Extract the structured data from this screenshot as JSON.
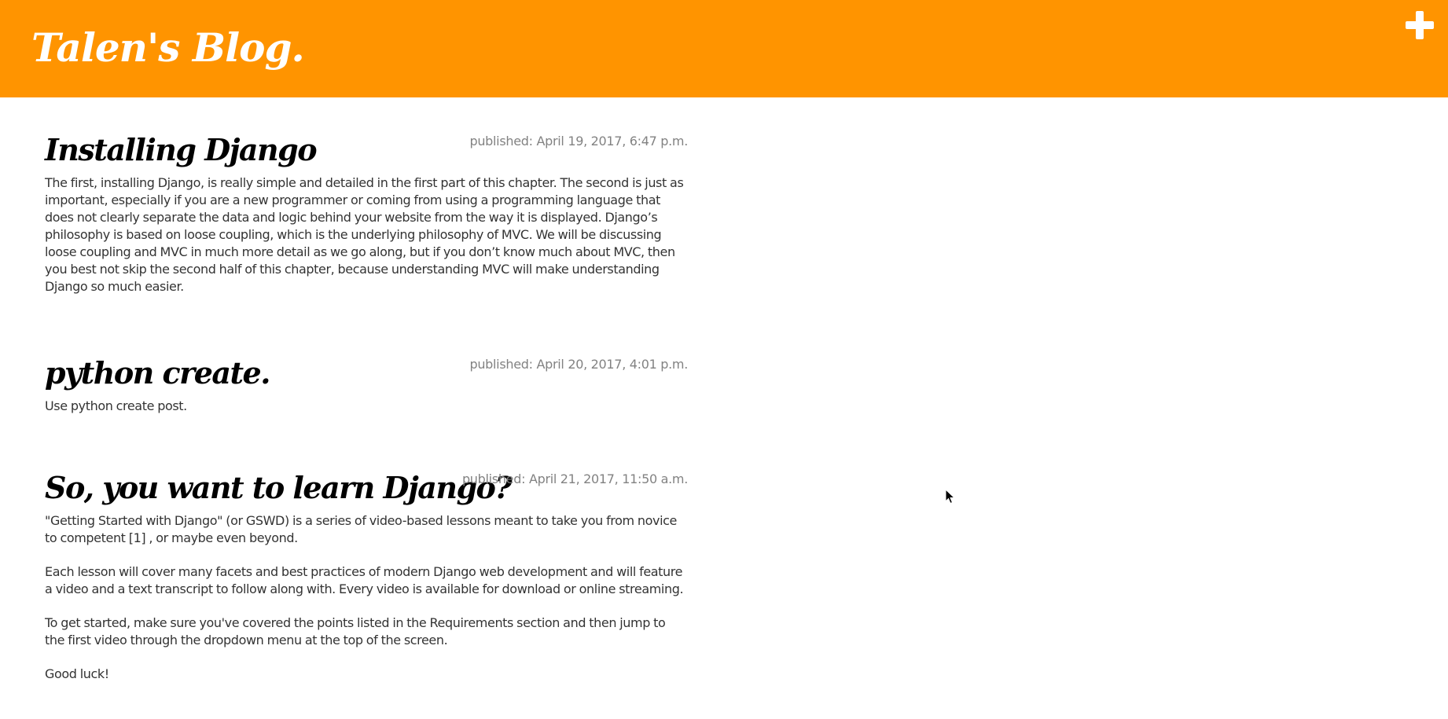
{
  "header": {
    "site_title": "Talen's Blog.",
    "add_icon": "plus-icon",
    "background_color": "#ff9400"
  },
  "posts": [
    {
      "title": "Installing Django",
      "date": "published: April 19, 2017, 6:47 p.m.",
      "paragraphs": [
        "The first, installing Django, is really simple and detailed in the first part of this chapter. The second is just as important, especially if you are a new programmer or coming from using a programming language that does not clearly separate the data and logic behind your website from the way it is displayed. Django’s philosophy is based on loose coupling, which is the underlying philosophy of MVC. We will be discussing loose coupling and MVC in much more detail as we go along, but if you don’t know much about MVC, then you best not skip the second half of this chapter, because understanding MVC will make understanding Django so much easier."
      ]
    },
    {
      "title": "python create.",
      "date": "published: April 20, 2017, 4:01 p.m.",
      "paragraphs": [
        "Use python create post."
      ]
    },
    {
      "title": "So, you want to learn Django?",
      "date": "published: April 21, 2017, 11:50 a.m.",
      "paragraphs": [
        "\"Getting Started with Django\" (or GSWD) is a series of video-based lessons meant to take you from novice to competent [1] , or maybe even beyond.",
        "Each lesson will cover many facets and best practices of modern Django web development and will feature a video and a text transcript to follow along with. Every video is available for download or online streaming.",
        "To get started, make sure you've covered the points listed in the Requirements section and then jump to the first video through the dropdown menu at the top of the screen.",
        "Good luck!"
      ]
    }
  ]
}
